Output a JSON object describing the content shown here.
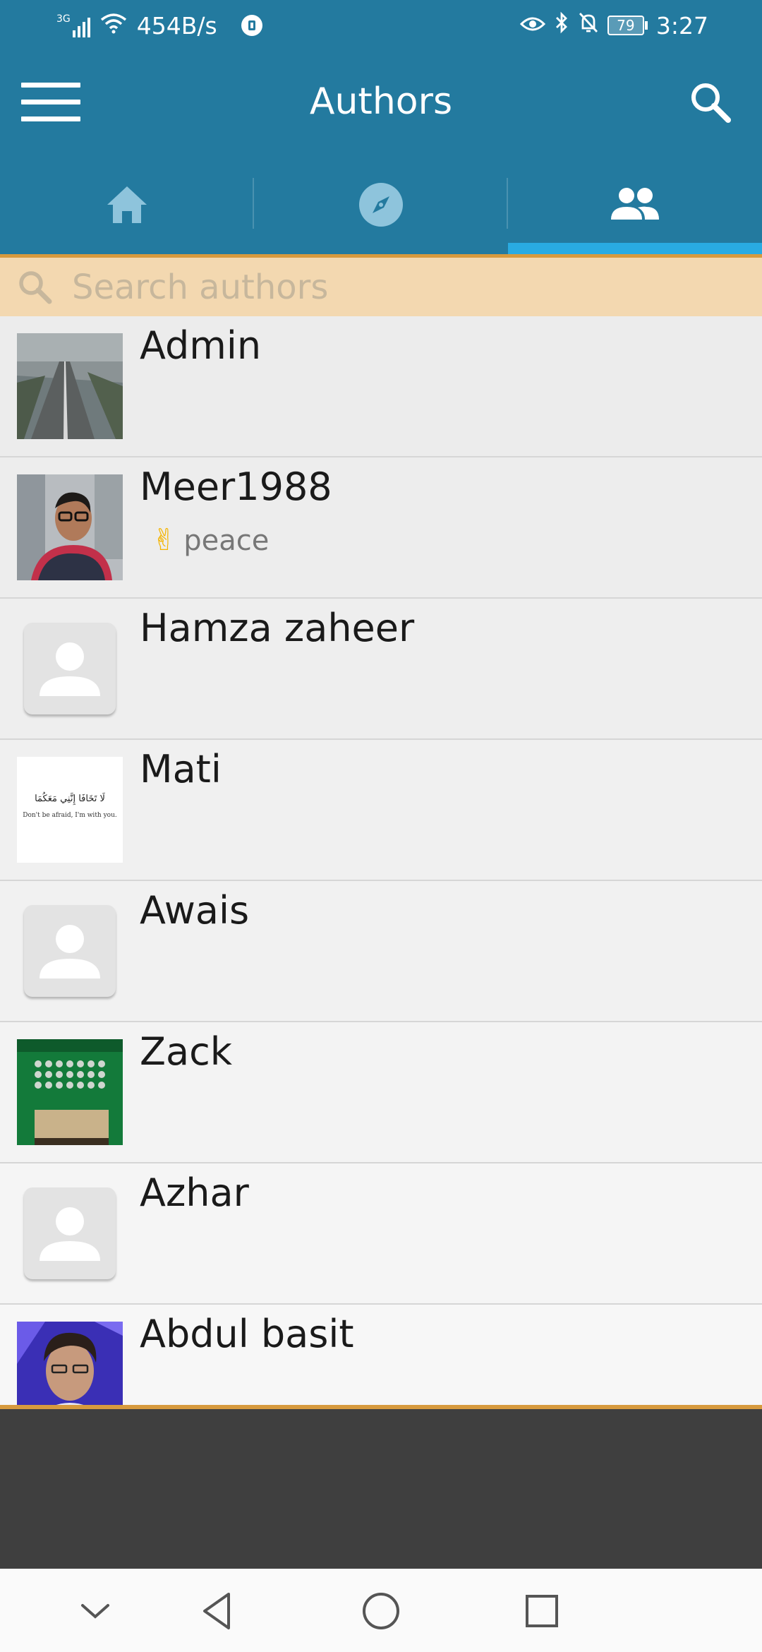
{
  "status_bar": {
    "network": "3G",
    "speed": "454B/s",
    "battery": "79",
    "time": "3:27"
  },
  "app_bar": {
    "title": "Authors"
  },
  "tabs": [
    {
      "icon": "home-icon",
      "active": false
    },
    {
      "icon": "compass-icon",
      "active": false
    },
    {
      "icon": "people-icon",
      "active": true
    }
  ],
  "search": {
    "placeholder": "Search authors"
  },
  "authors": [
    {
      "name": "Admin",
      "status": "",
      "avatar": "photo-road"
    },
    {
      "name": "Meer1988",
      "status": "peace",
      "status_emoji": "✌",
      "avatar": "photo-selfie"
    },
    {
      "name": "Hamza zaheer",
      "status": "",
      "avatar": "placeholder"
    },
    {
      "name": "Mati",
      "status": "",
      "avatar": "photo-quote",
      "avatar_text_arabic": "لَا تَخَافَا إِنَّنِي مَعَكُمَا",
      "avatar_text": "Don't be afraid, I'm with you."
    },
    {
      "name": "Awais",
      "status": "",
      "avatar": "placeholder"
    },
    {
      "name": "Zack",
      "status": "",
      "avatar": "photo-circuit"
    },
    {
      "name": "Azhar",
      "status": "",
      "avatar": "placeholder"
    },
    {
      "name": "Abdul basit",
      "status": "",
      "avatar": "photo-portrait"
    }
  ],
  "colors": {
    "primary": "#237a9f",
    "tab_indicator": "#29abe2",
    "accent_orange": "#d79a3e",
    "search_bg": "#f3d8b0"
  }
}
